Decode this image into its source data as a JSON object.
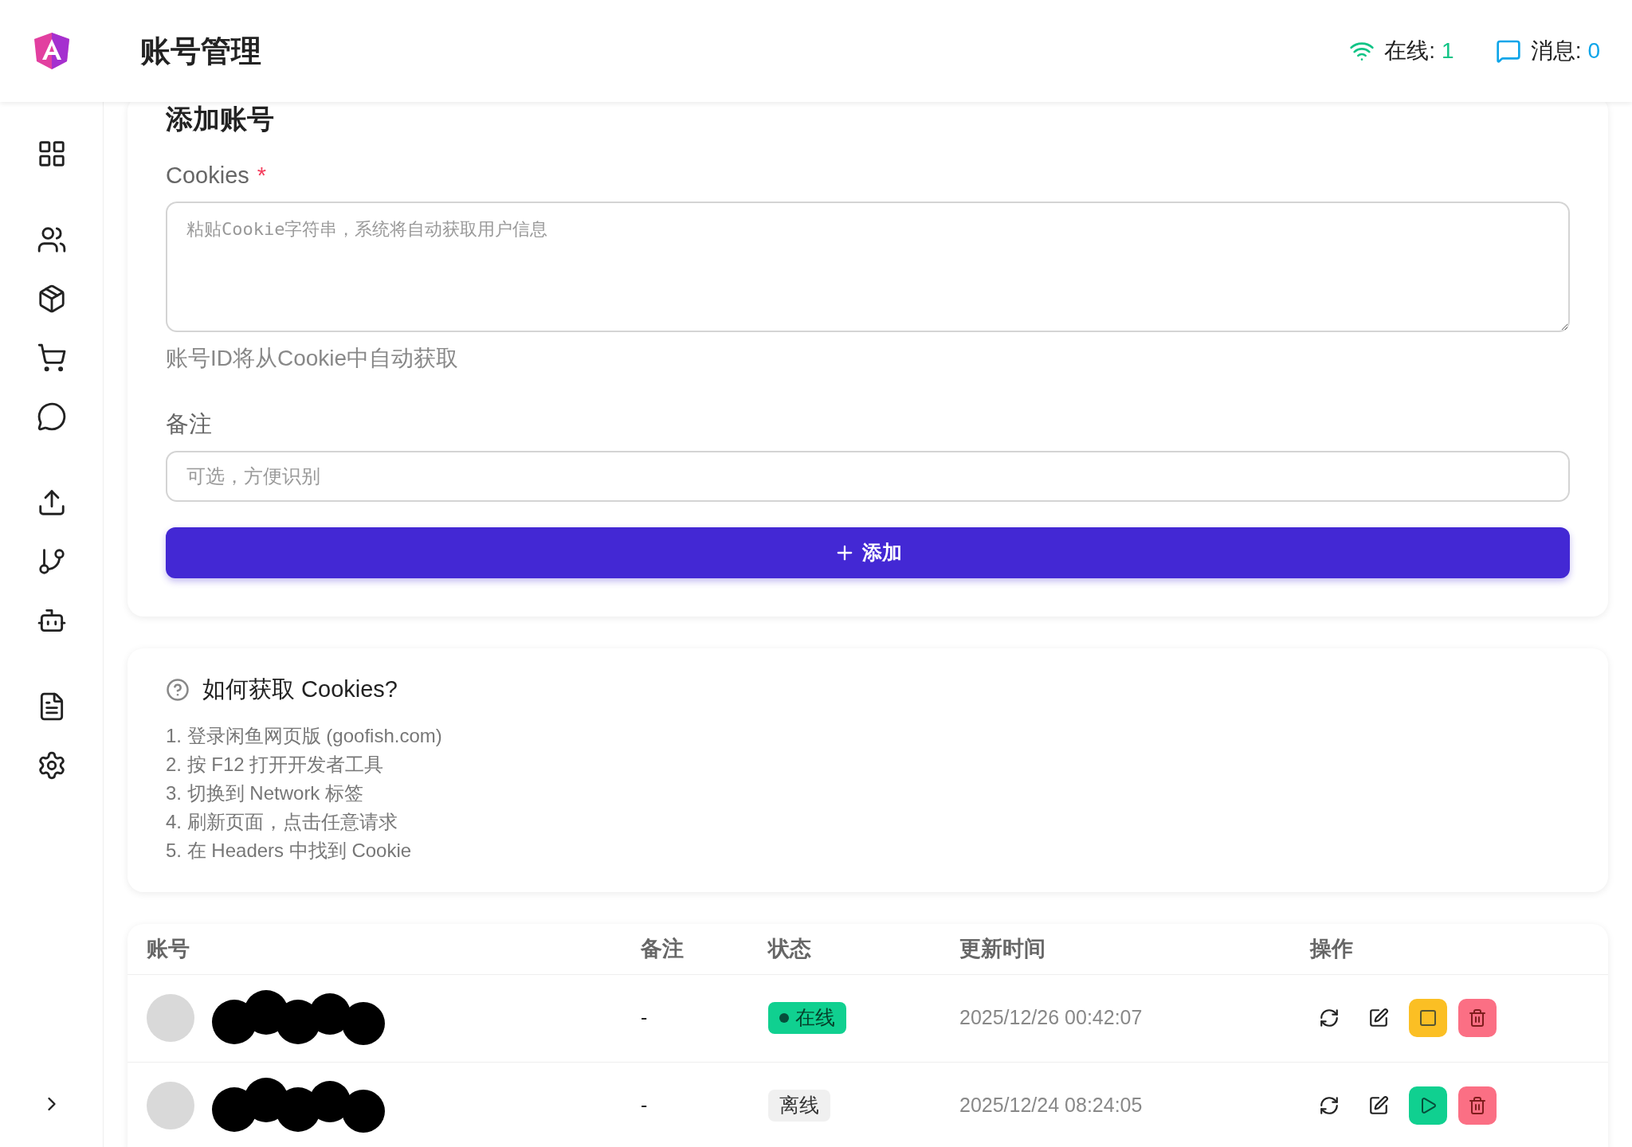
{
  "header": {
    "title": "账号管理",
    "online_label": "在线:",
    "online_count": "1",
    "messages_label": "消息:",
    "messages_count": "0"
  },
  "add_form": {
    "title": "添加账号",
    "cookies_label": "Cookies",
    "required_mark": "*",
    "cookies_placeholder": "粘贴Cookie字符串，系统将自动获取用户信息",
    "cookies_hint": "账号ID将从Cookie中自动获取",
    "remark_label": "备注",
    "remark_placeholder": "可选，方便识别",
    "submit": "添加"
  },
  "help": {
    "title": "如何获取 Cookies?",
    "steps": [
      "1. 登录闲鱼网页版 (goofish.com)",
      "2. 按 F12 打开开发者工具",
      "3. 切换到 Network 标签",
      "4. 刷新页面，点击任意请求",
      "5. 在 Headers 中找到 Cookie"
    ]
  },
  "table": {
    "columns": [
      "账号",
      "备注",
      "状态",
      "更新时间",
      "操作"
    ],
    "rows": [
      {
        "remark": "-",
        "status": "在线",
        "online": true,
        "updated": "2025/12/26 00:42:07"
      },
      {
        "remark": "-",
        "status": "离线",
        "online": false,
        "updated": "2025/12/24 08:24:05"
      }
    ]
  }
}
